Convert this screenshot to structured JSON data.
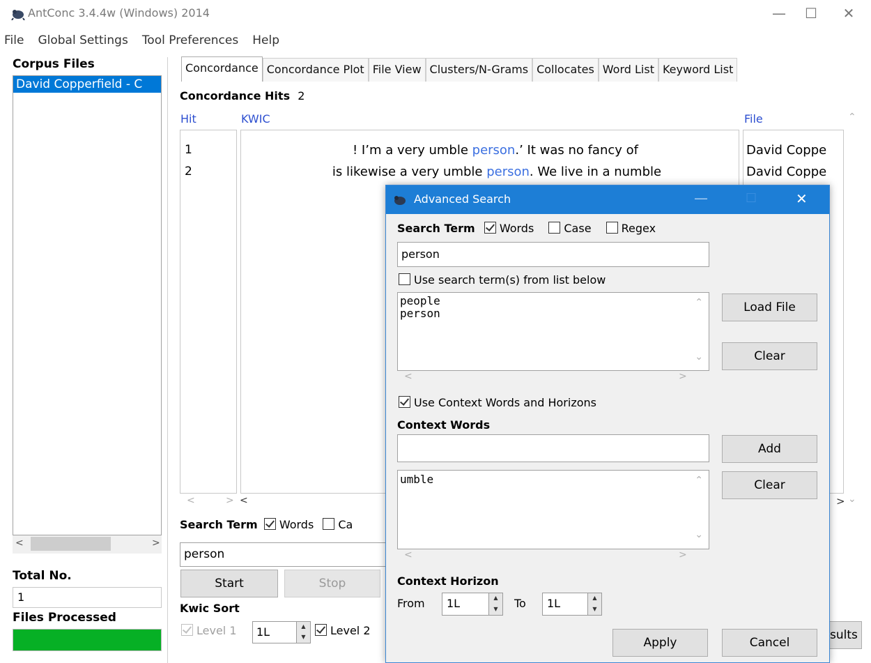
{
  "window": {
    "title": "AntConc 3.4.4w (Windows) 2014",
    "minimize": "—",
    "maximize": "☐",
    "close": "✕"
  },
  "menu": [
    "File",
    "Global Settings",
    "Tool Preferences",
    "Help"
  ],
  "sidebar": {
    "corpus_files_label": "Corpus Files",
    "files": [
      "David Copperfield - C"
    ],
    "total_no_label": "Total No.",
    "total_no_value": "1",
    "files_processed_label": "Files Processed",
    "progress": 1.0
  },
  "tabs": [
    "Concordance",
    "Concordance Plot",
    "File View",
    "Clusters/N-Grams",
    "Collocates",
    "Word List",
    "Keyword List"
  ],
  "concordance": {
    "hits_label": "Concordance Hits",
    "hits_count": "2",
    "col_hit": "Hit",
    "col_kwic": "KWIC",
    "col_file": "File",
    "rows": [
      {
        "hit": "1",
        "left": "! I’m a very umble ",
        "kw": "person",
        "right": ".’  It was no fancy of",
        "file": "David Coppe"
      },
      {
        "hit": "2",
        "left": "is likewise a very umble ",
        "kw": "person",
        "right": ". We live in a numble",
        "file": "David Coppe"
      }
    ]
  },
  "search": {
    "label": "Search Term",
    "words_label": "Words",
    "case_label_partial": "Ca",
    "value": "person",
    "start_label": "Start",
    "stop_label": "Stop"
  },
  "kwic_sort": {
    "label": "Kwic Sort",
    "level1_label": "Level 1",
    "level1_value": "1L",
    "level2_label": "Level 2",
    "results_partial": "sults"
  },
  "dialog": {
    "title": "Advanced Search",
    "search_term_label": "Search Term",
    "words_label": "Words",
    "case_label": "Case",
    "regex_label": "Regex",
    "search_value": "person",
    "use_list_label": "Use search term(s) from list below",
    "term_list": [
      "people",
      "person"
    ],
    "load_file_label": "Load File",
    "clear_label": "Clear",
    "use_context_label": "Use Context Words and Horizons",
    "context_words_label": "Context Words",
    "context_input_value": "",
    "add_label": "Add",
    "context_list": [
      "umble"
    ],
    "clear2_label": "Clear",
    "horizon_label": "Context Horizon",
    "from_label": "From",
    "from_value": "1L",
    "to_label": "To",
    "to_value": "1L",
    "apply_label": "Apply",
    "cancel_label": "Cancel"
  },
  "colors": {
    "accent": "#1d7ed6",
    "selection": "#0078d7",
    "keyword": "#3b6fe0",
    "progress": "#06b025"
  }
}
